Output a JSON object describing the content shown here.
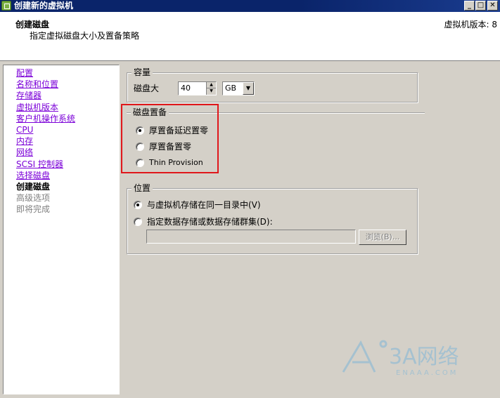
{
  "window": {
    "title": "创建新的虚拟机",
    "icon": "vm-icon",
    "controls": {
      "minimize": "_",
      "maximize": "□",
      "close": "✕"
    }
  },
  "header": {
    "title": "创建磁盘",
    "subtitle": "指定虚拟磁盘大小及置备策略",
    "version": "虚拟机版本: 8"
  },
  "nav": {
    "items": [
      {
        "label": "配置",
        "state": "link"
      },
      {
        "label": "名称和位置",
        "state": "link"
      },
      {
        "label": "存储器",
        "state": "link"
      },
      {
        "label": "虚拟机版本",
        "state": "link"
      },
      {
        "label": "客户机操作系统",
        "state": "link"
      },
      {
        "label": "CPU",
        "state": "link"
      },
      {
        "label": "内存",
        "state": "link"
      },
      {
        "label": "网络",
        "state": "link"
      },
      {
        "label": "SCSI 控制器",
        "state": "link"
      },
      {
        "label": "选择磁盘",
        "state": "link"
      },
      {
        "label": "创建磁盘",
        "state": "current"
      },
      {
        "label": "高级选项",
        "state": "disabled"
      },
      {
        "label": "即将完成",
        "state": "disabled"
      }
    ]
  },
  "capacity": {
    "legend": "容量",
    "disk_size_label": "磁盘大",
    "disk_size_value": "40",
    "unit_value": "GB"
  },
  "provisioning": {
    "legend": "磁盘置备",
    "options": [
      {
        "label": "厚置备延迟置零",
        "checked": true
      },
      {
        "label": "厚置备置零",
        "checked": false
      },
      {
        "label": "Thin Provision",
        "checked": false
      }
    ]
  },
  "location": {
    "legend": "位置",
    "options": [
      {
        "label": "与虚拟机存储在同一目录中(V)",
        "checked": true
      },
      {
        "label": "指定数据存储或数据存储群集(D):",
        "checked": false
      }
    ],
    "path_value": "",
    "browse_label": "浏览(B)..."
  },
  "watermark": {
    "brand": "3A网络",
    "domain": "ENAAA.COM"
  },
  "colors": {
    "title_bar": "#0a246a",
    "highlight_box": "#e0171b",
    "link": "#7b00d8",
    "panel": "#d4d0c8"
  }
}
